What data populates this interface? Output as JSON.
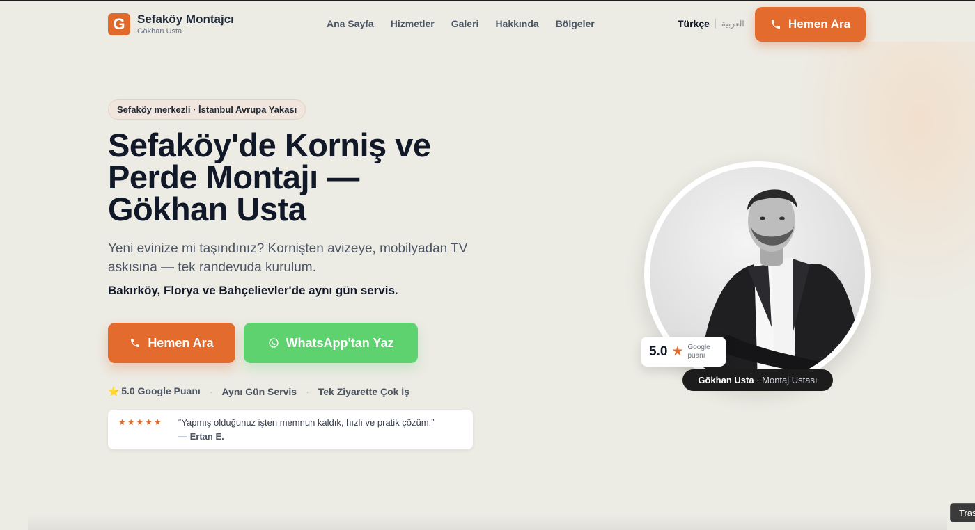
{
  "brand": {
    "logo_letter": "G",
    "name": "Sefaköy Montajcı",
    "sub": "Gökhan Usta"
  },
  "nav": {
    "items": [
      "Ana Sayfa",
      "Hizmetler",
      "Galeri",
      "Hakkında",
      "Bölgeler"
    ]
  },
  "lang": {
    "active": "Türkçe",
    "other": "العربية"
  },
  "header_call": {
    "label": "Hemen Ara"
  },
  "hero": {
    "badge": "Sefaköy merkezli · İstanbul Avrupa Yakası",
    "title_line1": "Sefaköy'de Korniş ve",
    "title_line2": "Perde Montajı —",
    "title_line3": "Gökhan Usta",
    "subtitle": "Yeni evinize mi taşındınız? Kornişten avizeye, mobilyadan TV askısına — tek randevuda kurulum.",
    "service_line": "Bakırköy, Florya ve Bahçelievler'de aynı gün servis.",
    "call_label": "Hemen Ara",
    "whatsapp_label": "WhatsApp'tan Yaz",
    "features": [
      "5.0 Google Puanı",
      "Aynı Gün Servis",
      "Tek Ziyarette Çok İş"
    ]
  },
  "review": {
    "stars": "★★★★★",
    "quote": "“Yapmış olduğunuz işten memnun kaldık, hızlı ve pratik çözüm.”",
    "author": "— Ertan E."
  },
  "rating_card": {
    "score": "5.0",
    "label_line1": "Google",
    "label_line2": "puanı"
  },
  "name_pill": {
    "name": "Gökhan Usta",
    "role": "· Montaj Ustası"
  },
  "translate_tab": {
    "label": "Tras"
  },
  "colors": {
    "accent": "#e36b2e",
    "whatsapp": "#5fd270",
    "background": "#ecebe4"
  }
}
